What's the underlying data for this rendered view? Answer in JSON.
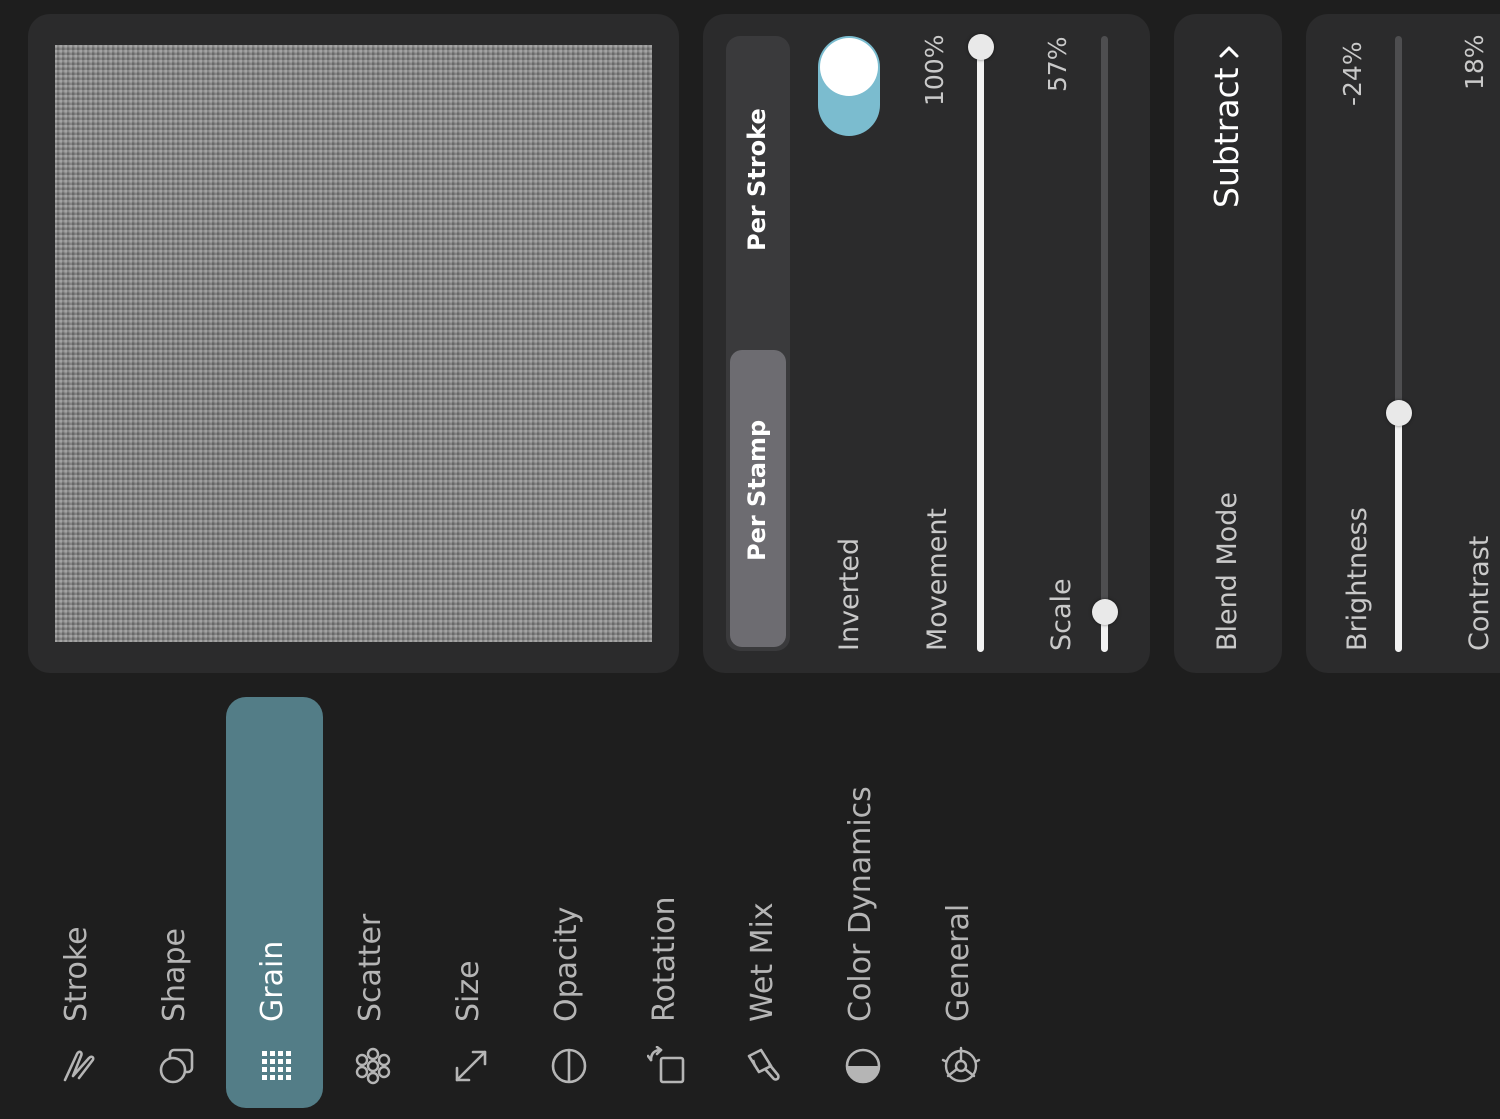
{
  "sidebar": {
    "items": [
      {
        "label": "Stroke",
        "icon": "stroke-path-icon",
        "active": false
      },
      {
        "label": "Shape",
        "icon": "shape-icon",
        "active": false
      },
      {
        "label": "Grain",
        "icon": "grain-grid-icon",
        "active": true
      },
      {
        "label": "Scatter",
        "icon": "scatter-flower-icon",
        "active": false
      },
      {
        "label": "Size",
        "icon": "size-arrows-icon",
        "active": false
      },
      {
        "label": "Opacity",
        "icon": "opacity-circle-icon",
        "active": false
      },
      {
        "label": "Rotation",
        "icon": "rotation-icon",
        "active": false
      },
      {
        "label": "Wet Mix",
        "icon": "wet-mix-brush-icon",
        "active": false
      },
      {
        "label": "Color Dynamics",
        "icon": "color-dynamics-icon",
        "active": false
      },
      {
        "label": "General",
        "icon": "general-gear-icon",
        "active": false
      }
    ],
    "active_color": "#537d87"
  },
  "grain_behavior": {
    "segments": [
      "Per Stamp",
      "Per Stroke"
    ],
    "selected": "Per Stamp",
    "inverted": {
      "label": "Inverted",
      "on": true,
      "color": "#7bbccf"
    },
    "movement": {
      "label": "Movement",
      "value_text": "100%",
      "value": 1.0
    },
    "scale": {
      "label": "Scale",
      "value_text": "57%",
      "value": 0.07
    }
  },
  "blend": {
    "label": "Blend Mode",
    "value": "Subtract",
    "chevron": "chevron-up-icon"
  },
  "adjustments": {
    "brightness": {
      "label": "Brightness",
      "value_text": "-24%",
      "value": 0.38
    },
    "contrast": {
      "label": "Contrast",
      "value_text": "18%"
    }
  }
}
